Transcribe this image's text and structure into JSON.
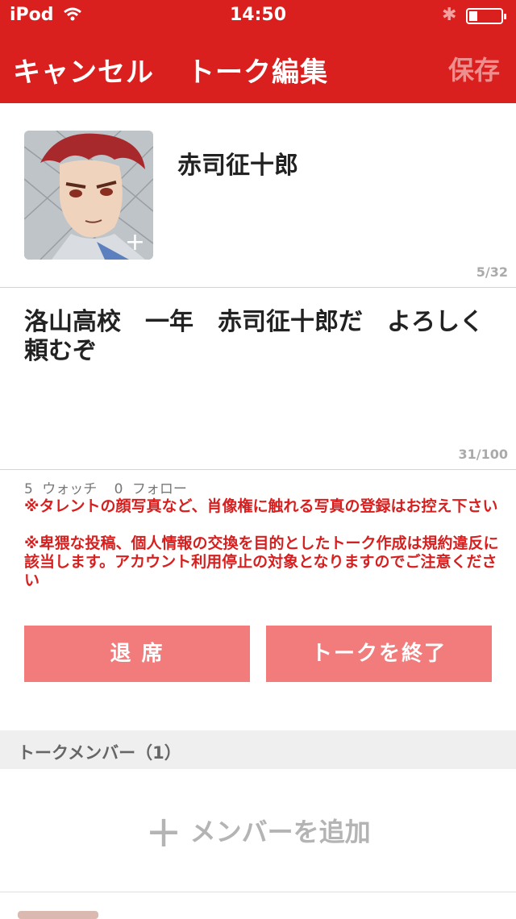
{
  "status_bar": {
    "carrier": "iPod",
    "time": "14:50"
  },
  "nav": {
    "cancel_label": "キャンセル",
    "title": "トーク編集",
    "save_label": "保存"
  },
  "talk": {
    "name": "赤司征十郎",
    "name_count": "5/32",
    "description": "洛山高校　一年　赤司征十郎だ　よろしく頼むぞ",
    "description_count": "31/100"
  },
  "stats": {
    "watch_count": "5",
    "watch_label": "ウォッチ",
    "follow_count": "0",
    "follow_label": "フォロー"
  },
  "warnings": [
    "※タレントの顔写真など、肖像権に触れる写真の登録はお控え下さい",
    "※卑猥な投稿、個人情報の交換を目的としたトーク作成は規約違反に該当します。アカウント利用停止の対象となりますのでご注意ください"
  ],
  "buttons": {
    "leave": "退 席",
    "end_talk": "トークを終了"
  },
  "members": {
    "header": "トークメンバー（1）",
    "add_label": "メンバーを追加"
  },
  "colors": {
    "accent": "#d9201f",
    "button": "#f27b7b",
    "warning": "#d62020"
  }
}
